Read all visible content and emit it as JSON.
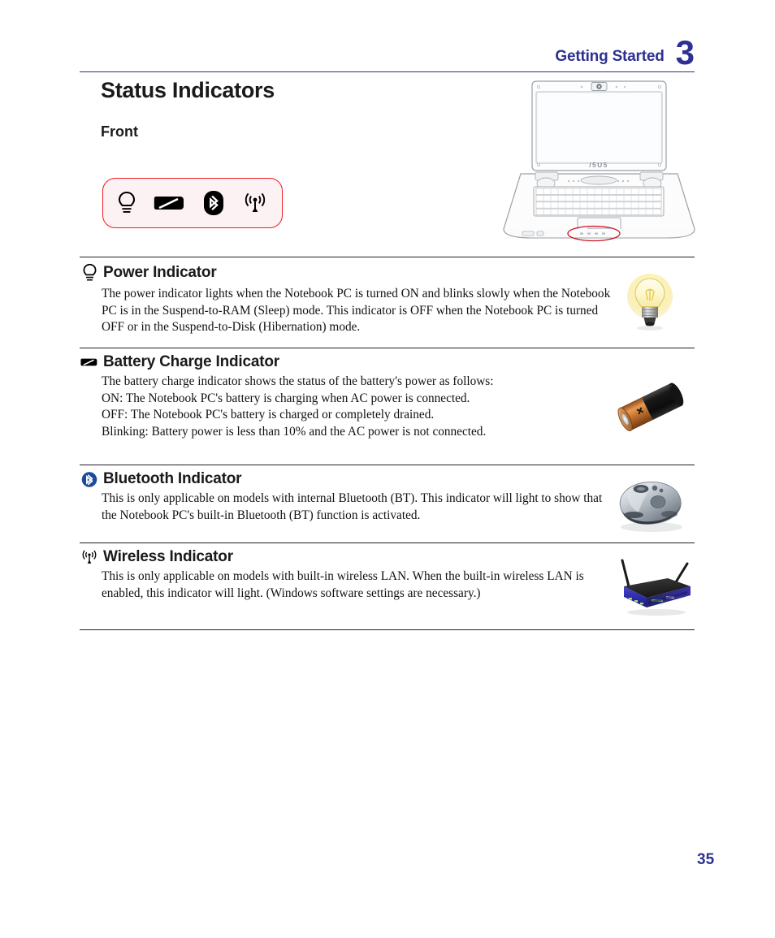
{
  "header": {
    "chapter_title": "Getting Started",
    "chapter_number": "3",
    "accent_color": "#2e3192"
  },
  "document": {
    "title": "Status Indicators",
    "subtitle": "Front",
    "page_number": "35"
  },
  "indicator_panel": {
    "outline_color": "#ed1c24",
    "icons": [
      {
        "name": "power-icon",
        "label": "Power"
      },
      {
        "name": "battery-icon",
        "label": "Battery Charge"
      },
      {
        "name": "bluetooth-icon",
        "label": "Bluetooth"
      },
      {
        "name": "wireless-icon",
        "label": "Wireless"
      }
    ]
  },
  "illustration": {
    "name": "asus-notebook-front-view",
    "brand_text": "ASUS",
    "highlight_color": "#cc1122"
  },
  "sections": [
    {
      "id": "power",
      "icon": "power-icon",
      "title": "Power Indicator",
      "body": "The power indicator lights when the Notebook PC is turned ON and blinks slowly when the Notebook PC is in the Suspend-to-RAM (Sleep) mode. This indicator is OFF when the Notebook PC is turned OFF or in the Suspend-to-Disk (Hibernation) mode.",
      "figure": "lightbulb-photo"
    },
    {
      "id": "battery",
      "icon": "battery-icon",
      "title": "Battery Charge Indicator",
      "body": "The battery charge indicator shows the status of the battery's power as follows:",
      "sub_lines": [
        "ON:  The Notebook PC's battery is charging when AC power is connected.",
        "OFF:  The Notebook PC's battery is charged or completely drained.",
        "Blinking:  Battery power is less than 10% and the AC power is not connected."
      ],
      "figure": "battery-photo"
    },
    {
      "id": "bluetooth",
      "icon": "bluetooth-icon",
      "title": "Bluetooth Indicator",
      "body": "This is only applicable on models with internal Bluetooth (BT). This indicator will light to show that the Notebook PC's built-in Bluetooth (BT) function is activated.",
      "figure": "wireless-mouse-photo"
    },
    {
      "id": "wireless",
      "icon": "wireless-icon",
      "title": "Wireless Indicator",
      "body": "This is only applicable on models with built-in wireless LAN. When the built-in wireless LAN is enabled, this indicator will light. (Windows software settings are necessary.)",
      "figure": "wireless-router-photo"
    }
  ]
}
